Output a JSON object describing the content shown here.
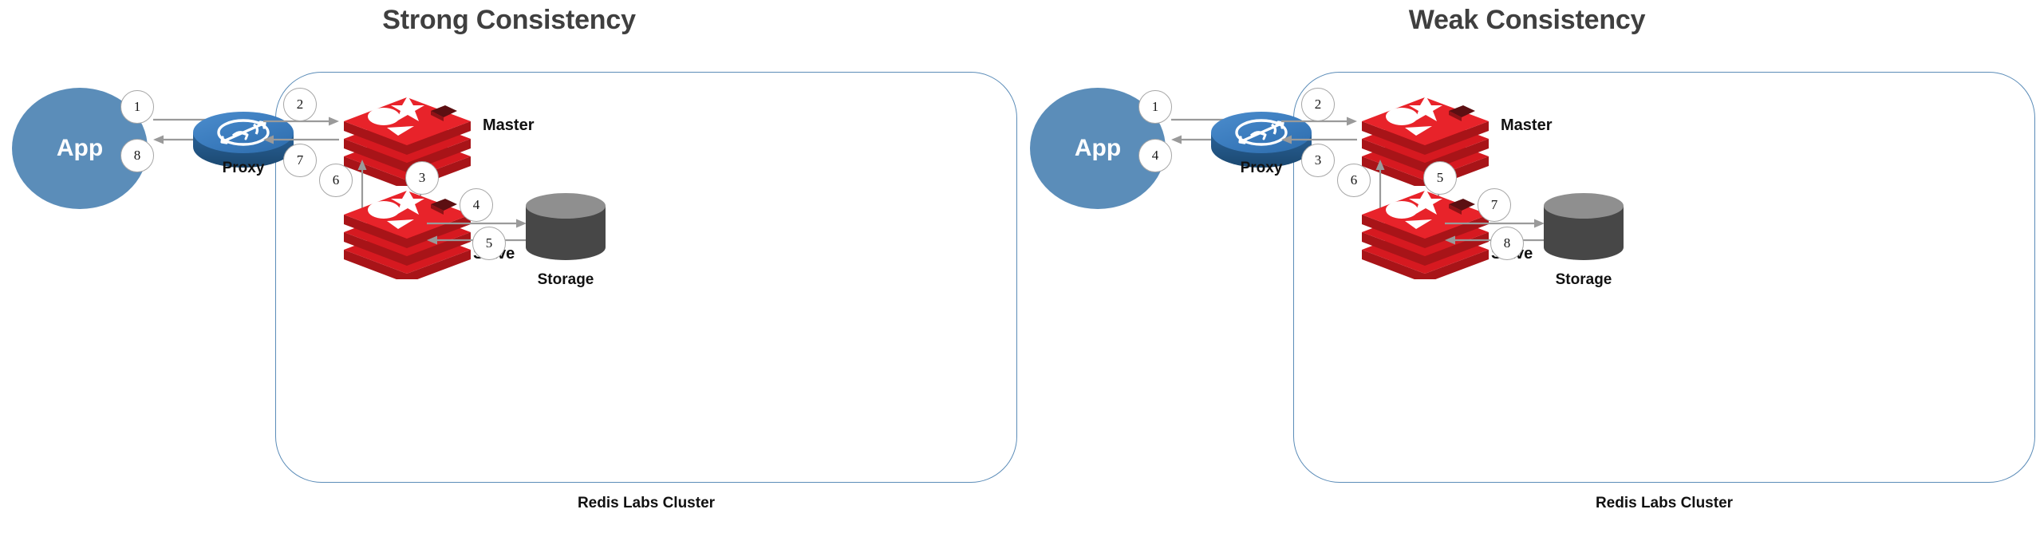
{
  "colors": {
    "title": "#3f3f3f",
    "cluster_border": "#5b8cb8",
    "app_fill": "#5b8db9",
    "proxy_top": "#3b7cc0",
    "proxy_side": "#1f4e79",
    "redis_light": "#e8232a",
    "redis_mid": "#d61920",
    "redis_dark": "#a81418",
    "storage_body": "#474747",
    "storage_top": "#8f8f8f",
    "arrow": "#9a9a9a",
    "step_border": "#a6a6a6",
    "label": "#111111"
  },
  "panels": [
    {
      "id": "strong",
      "title": "Strong Consistency",
      "cluster_caption": "Redis Labs Cluster",
      "nodes": {
        "app": {
          "label": "App",
          "icon": "app-ellipse-icon"
        },
        "proxy": {
          "label": "Proxy",
          "icon": "proxy-router-icon"
        },
        "master": {
          "label": "Master",
          "icon": "redis-stack-icon"
        },
        "slave": {
          "label": "Slave",
          "icon": "redis-stack-icon"
        },
        "storage": {
          "label": "Storage",
          "icon": "storage-cylinder-icon"
        }
      },
      "steps": [
        {
          "n": "1",
          "from": "app",
          "to": "proxy",
          "dir": "right"
        },
        {
          "n": "8",
          "from": "proxy",
          "to": "app",
          "dir": "left"
        },
        {
          "n": "2",
          "from": "proxy",
          "to": "master",
          "dir": "right"
        },
        {
          "n": "7",
          "from": "master",
          "to": "proxy",
          "dir": "left"
        },
        {
          "n": "3",
          "from": "master",
          "to": "slave",
          "dir": "down"
        },
        {
          "n": "6",
          "from": "slave",
          "to": "master",
          "dir": "up"
        },
        {
          "n": "4",
          "from": "slave",
          "to": "storage",
          "dir": "right"
        },
        {
          "n": "5",
          "from": "storage",
          "to": "slave",
          "dir": "left"
        }
      ]
    },
    {
      "id": "weak",
      "title": "Weak Consistency",
      "cluster_caption": "Redis Labs Cluster",
      "nodes": {
        "app": {
          "label": "App",
          "icon": "app-ellipse-icon"
        },
        "proxy": {
          "label": "Proxy",
          "icon": "proxy-router-icon"
        },
        "master": {
          "label": "Master",
          "icon": "redis-stack-icon"
        },
        "slave": {
          "label": "Slave",
          "icon": "redis-stack-icon"
        },
        "storage": {
          "label": "Storage",
          "icon": "storage-cylinder-icon"
        }
      },
      "steps": [
        {
          "n": "1",
          "from": "app",
          "to": "proxy",
          "dir": "right"
        },
        {
          "n": "4",
          "from": "proxy",
          "to": "app",
          "dir": "left"
        },
        {
          "n": "2",
          "from": "proxy",
          "to": "master",
          "dir": "right"
        },
        {
          "n": "3",
          "from": "master",
          "to": "proxy",
          "dir": "left"
        },
        {
          "n": "5",
          "from": "master",
          "to": "slave",
          "dir": "down"
        },
        {
          "n": "6",
          "from": "slave",
          "to": "master",
          "dir": "up"
        },
        {
          "n": "7",
          "from": "slave",
          "to": "storage",
          "dir": "right"
        },
        {
          "n": "8",
          "from": "storage",
          "to": "slave",
          "dir": "left"
        }
      ]
    }
  ]
}
